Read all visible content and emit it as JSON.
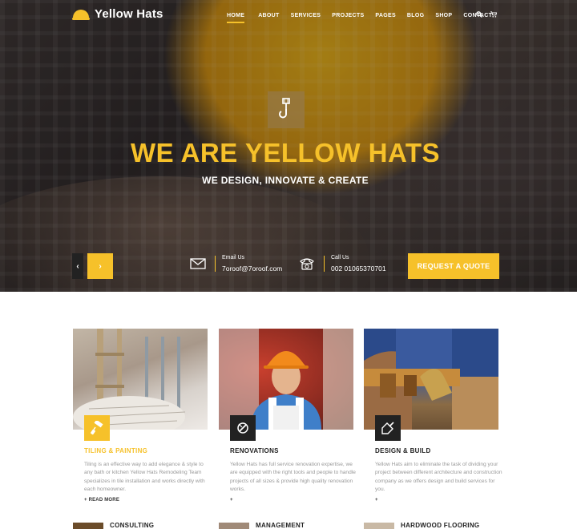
{
  "brand": {
    "name": "Yellow Hats"
  },
  "nav": {
    "items": [
      {
        "label": "HOME",
        "active": true
      },
      {
        "label": "ABOUT"
      },
      {
        "label": "SERVICES"
      },
      {
        "label": "PROJECTS"
      },
      {
        "label": "PAGES"
      },
      {
        "label": "BLOG"
      },
      {
        "label": "SHOP"
      },
      {
        "label": "CONTACT"
      }
    ],
    "icons": [
      "search-icon",
      "cart-icon"
    ]
  },
  "hero": {
    "title": "WE ARE YELLOW HATS",
    "subtitle": "WE DESIGN, INNOVATE & CREATE",
    "prev_arrow": "‹",
    "next_arrow": "›",
    "email": {
      "label": "Email Us",
      "value": "7oroof@7oroof.com"
    },
    "call": {
      "label": "Call Us",
      "value": "002 01065370701"
    },
    "cta": "REQUEST A QUOTE"
  },
  "services": [
    {
      "title": "TILING & PAINTING",
      "title_color": "#f6c12a",
      "icon": "paint-roller-icon",
      "icon_bg": "#f6c12a",
      "description": "Tiling is an effective way to add elegance & style to any bath or kitchen Yellow Hats Remodeling Team specializes in tile installation and works directly with each homeowner.",
      "more": "+ READ MORE"
    },
    {
      "title": "RENOVATIONS",
      "title_color": "#222222",
      "icon": "tools-icon",
      "icon_bg": "#222222",
      "description": "Yellow Hats has full service renovation expertise, we are equipped with the right tools and people to handle projects of all sizes & provide high quality renovation works.",
      "more": "+"
    },
    {
      "title": "DESIGN & BUILD",
      "title_color": "#222222",
      "icon": "trowel-icon",
      "icon_bg": "#222222",
      "description": "Yellow Hats aim to eliminate the task of dividing your project between different architecture and construction company as we offers design and build services for you.",
      "more": "+"
    }
  ],
  "more_services": [
    {
      "title": "CONSULTING"
    },
    {
      "title": "MANAGEMENT"
    },
    {
      "title": "HARDWOOD FLOORING"
    }
  ],
  "colors": {
    "accent": "#f6c12a",
    "dark": "#222222",
    "muted": "#999999"
  }
}
